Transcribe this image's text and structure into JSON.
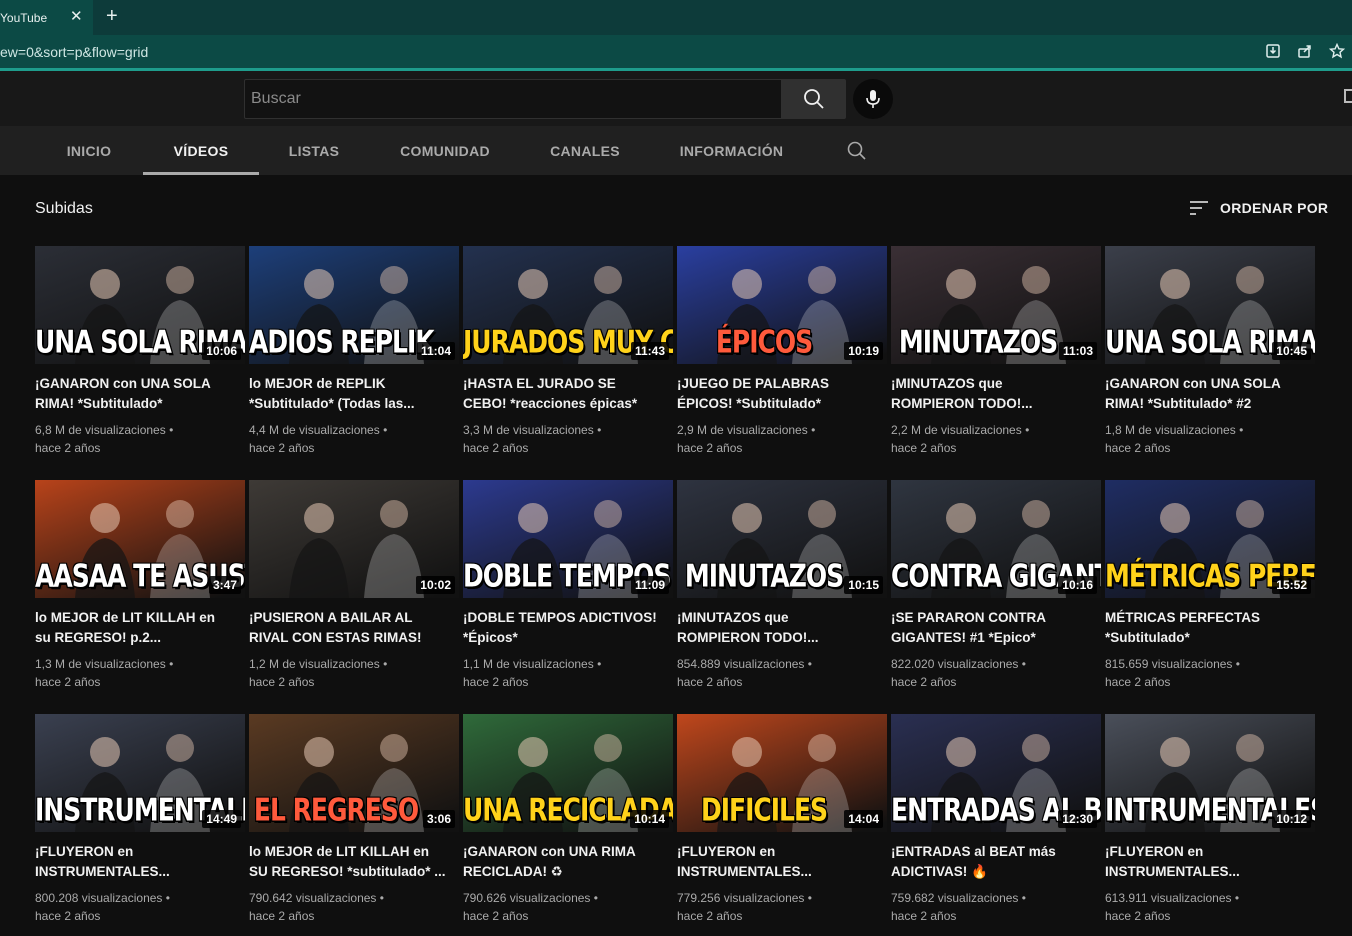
{
  "browser": {
    "tab_title": "YouTube",
    "tab_close": "✕",
    "new_tab": "+",
    "url": "ew=0&sort=p&flow=grid"
  },
  "masthead": {
    "search_placeholder": "Buscar"
  },
  "channel_tabs": [
    {
      "label": "INICIO",
      "active": false
    },
    {
      "label": "VÍDEOS",
      "active": true
    },
    {
      "label": "LISTAS",
      "active": false
    },
    {
      "label": "COMUNIDAD",
      "active": false
    },
    {
      "label": "CANALES",
      "active": false
    },
    {
      "label": "INFORMACIÓN",
      "active": false
    }
  ],
  "section": {
    "title": "Subidas",
    "sort_label": "ORDENAR POR"
  },
  "videos": [
    {
      "title_line1": "¡GANARON con UNA SOLA",
      "title_line2": "RIMA! *Subtitulado*",
      "views": "6,8 M de visualizaciones",
      "age": "hace 2 años",
      "duration": "10:06",
      "caption": "UNA SOLA RIMA",
      "caption_color": "white",
      "bg": "#2b2e36"
    },
    {
      "title_line1": "lo MEJOR de REPLIK",
      "title_line2": "*Subtitulado* (Todas las...",
      "views": "4,4 M de visualizaciones",
      "age": "hace 2 años",
      "duration": "11:04",
      "caption": "ADIOS REPLIK",
      "caption_color": "white",
      "bg": "#1d3f7a"
    },
    {
      "title_line1": "¡HASTA EL JURADO SE",
      "title_line2": "CEBO! *reacciones épicas*",
      "views": "3,3 M de visualizaciones",
      "age": "hace 2 años",
      "duration": "11:43",
      "caption": "JURADOS MUY CEBADOS",
      "caption_color": "yellow",
      "bg": "#23314f"
    },
    {
      "title_line1": "¡JUEGO DE PALABRAS",
      "title_line2": "ÉPICOS! *Subtitulado*",
      "views": "2,9 M de visualizaciones",
      "age": "hace 2 años",
      "duration": "10:19",
      "caption": "ÉPICOS",
      "caption_color": "red",
      "bg": "#2a3fa0"
    },
    {
      "title_line1": "¡MINUTAZOS que",
      "title_line2": "ROMPIERON TODO!...",
      "views": "2,2 M de visualizaciones",
      "age": "hace 2 años",
      "duration": "11:03",
      "caption": "MINUTAZOS",
      "caption_color": "white",
      "bg": "#3a2f35"
    },
    {
      "title_line1": "¡GANARON con UNA SOLA",
      "title_line2": "RIMA! *Subtitulado* #2",
      "views": "1,8 M de visualizaciones",
      "age": "hace 2 años",
      "duration": "10:45",
      "caption": "UNA SOLA RIMA",
      "caption_color": "white",
      "bg": "#3b3f4a"
    },
    {
      "title_line1": "lo MEJOR de LIT KILLAH en",
      "title_line2": "su REGRESO! p.2...",
      "views": "1,3 M de visualizaciones",
      "age": "hace 2 años",
      "duration": "3:47",
      "caption": "AASAA TE ASUSTASTE!",
      "caption_color": "white",
      "bg": "#b8431a"
    },
    {
      "title_line1": "¡PUSIERON A BAILAR AL",
      "title_line2": "RIVAL CON ESTAS RIMAS!",
      "views": "1,2 M de visualizaciones",
      "age": "hace 2 años",
      "duration": "10:02",
      "caption": "",
      "caption_color": "white",
      "bg": "#3e3a36"
    },
    {
      "title_line1": "¡DOBLE TEMPOS ADICTIVOS!",
      "title_line2": "*Épicos*",
      "views": "1,1 M de visualizaciones",
      "age": "hace 2 años",
      "duration": "11:09",
      "caption": "DOBLE TEMPOS",
      "caption_color": "white",
      "bg": "#2c3a8f"
    },
    {
      "title_line1": "¡MINUTAZOS que",
      "title_line2": "ROMPIERON TODO!...",
      "views": "854.889 visualizaciones",
      "age": "hace 2 años",
      "duration": "10:15",
      "caption": "MINUTAZOS",
      "caption_color": "white",
      "bg": "#2e3340"
    },
    {
      "title_line1": "¡SE PARARON CONTRA",
      "title_line2": "GIGANTES! #1 *Epico*",
      "views": "822.020 visualizaciones",
      "age": "hace 2 años",
      "duration": "10:16",
      "caption": "CONTRA GIGANTES",
      "caption_color": "white",
      "bg": "#2f3540"
    },
    {
      "title_line1": "MÉTRICAS PERFECTAS",
      "title_line2": "*Subtitulado*",
      "views": "815.659 visualizaciones",
      "age": "hace 2 años",
      "duration": "15:52",
      "caption": "MÉTRICAS PERFECTAS",
      "caption_color": "yellow",
      "bg": "#1f2d63"
    },
    {
      "title_line1": "¡FLUYERON en",
      "title_line2": "INSTRUMENTALES...",
      "views": "800.208 visualizaciones",
      "age": "hace 2 años",
      "duration": "14:49",
      "caption": "INSTRUMENTALES",
      "caption_color": "white",
      "bg": "#3a4050"
    },
    {
      "title_line1": "lo MEJOR de LIT KILLAH en",
      "title_line2": "SU REGRESO! *subtitulado* ...",
      "views": "790.642 visualizaciones",
      "age": "hace 2 años",
      "duration": "3:06",
      "caption": "EL REGRESO",
      "caption_color": "red",
      "bg": "#5a3a22"
    },
    {
      "title_line1": "¡GANARON con UNA RIMA",
      "title_line2": "RECICLADA! ♻",
      "views": "790.626 visualizaciones",
      "age": "hace 2 años",
      "duration": "10:14",
      "caption": "UNA RECICLADA",
      "caption_color": "yellow",
      "bg": "#2f6a3a"
    },
    {
      "title_line1": "¡FLUYERON en",
      "title_line2": "INSTRUMENTALES...",
      "views": "779.256 visualizaciones",
      "age": "hace 2 años",
      "duration": "14:04",
      "caption": "DIFICILES",
      "caption_color": "yellow",
      "bg": "#c0471c"
    },
    {
      "title_line1": "¡ENTRADAS al BEAT más",
      "title_line2": "ADICTIVAS! 🔥",
      "views": "759.682 visualizaciones",
      "age": "hace 2 años",
      "duration": "12:30",
      "caption": "ENTRADAS AL BEAT",
      "caption_color": "white",
      "bg": "#2a2f52"
    },
    {
      "title_line1": "¡FLUYERON en",
      "title_line2": "INSTRUMENTALES...",
      "views": "613.911 visualizaciones",
      "age": "hace 2 años",
      "duration": "10:12",
      "caption": "INTRUMENTALES",
      "caption_color": "white",
      "bg": "#4a4f5a"
    }
  ],
  "meta_separator": " •"
}
